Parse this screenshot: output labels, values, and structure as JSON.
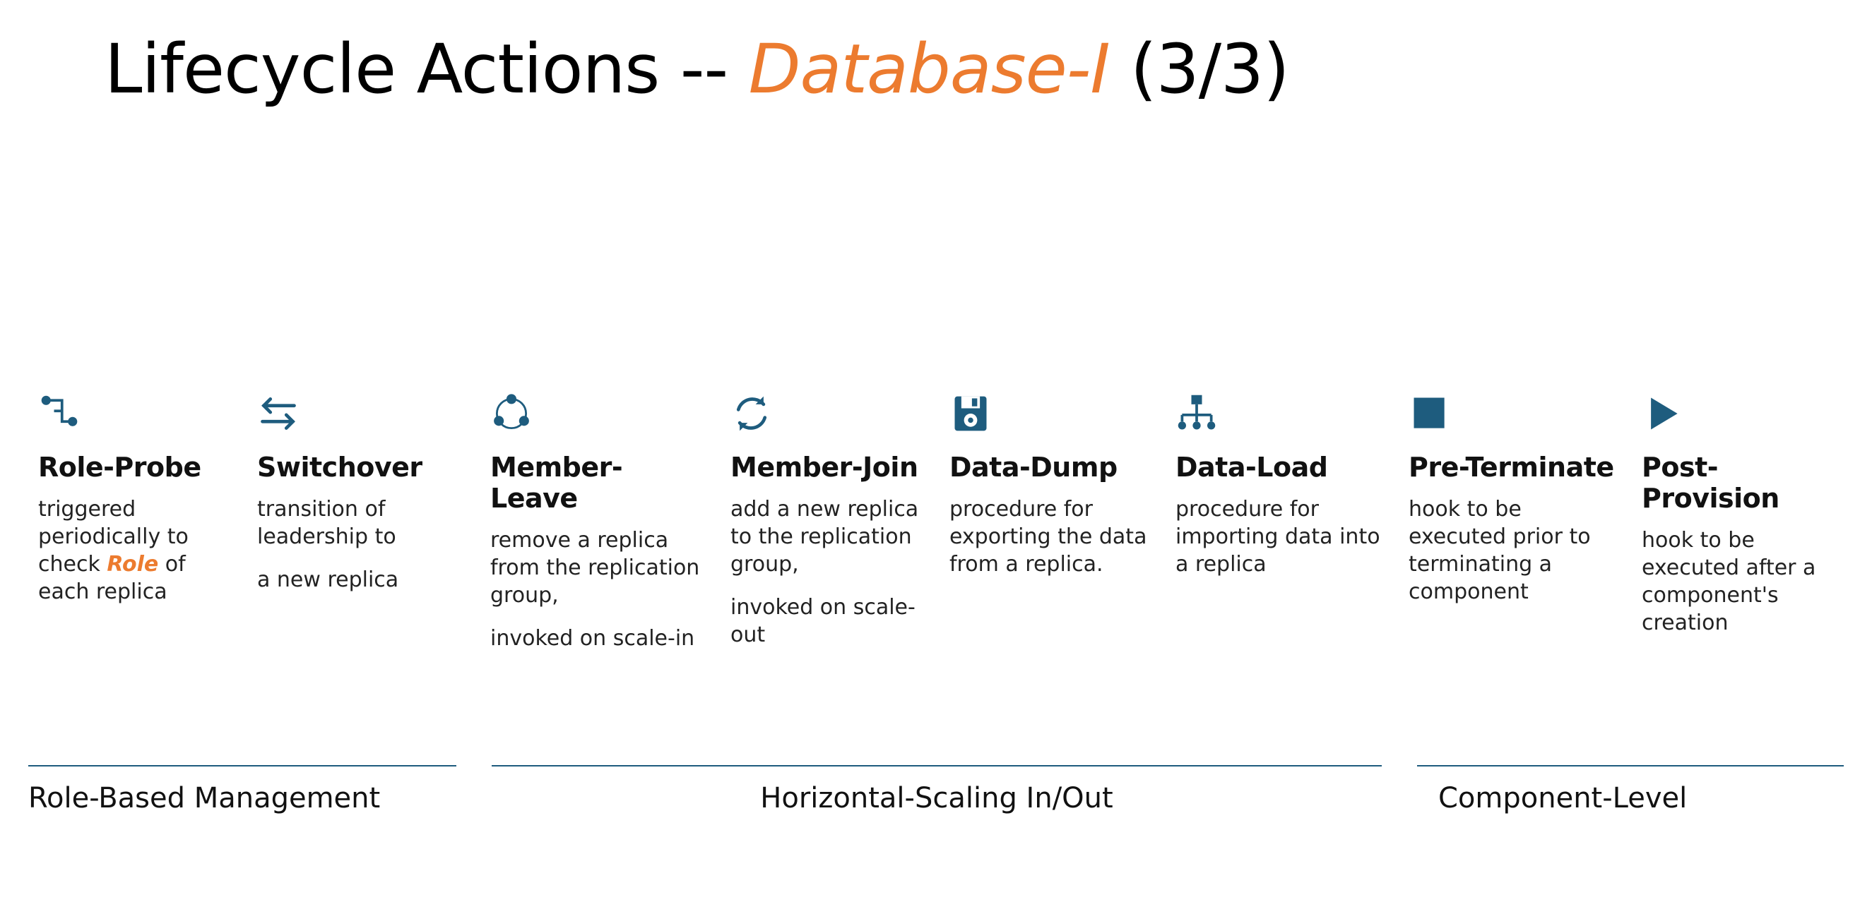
{
  "heading": {
    "prefix": "Lifecycle Actions -- ",
    "em": "Database-I",
    "suffix": " (3/3)"
  },
  "accentColor": "#EC7B2F",
  "iconColor": "#1E5C7E",
  "cards": [
    {
      "icon": "connect-icon",
      "title": "Role-Probe",
      "desc_pre": "triggered periodically to check ",
      "desc_key": "Role",
      "desc_post": " of each replica"
    },
    {
      "icon": "swap-icon",
      "title": "Switchover",
      "desc": "transition of leadership to",
      "desc2": "a new replica"
    },
    {
      "icon": "cycle-dots-icon",
      "title": "Member-Leave",
      "desc": "remove a replica from the replication group,",
      "desc2": "invoked on scale-in"
    },
    {
      "icon": "refresh-icon",
      "title": "Member-Join",
      "desc": "add a new replica to the replication group,",
      "desc2": "invoked on scale-out"
    },
    {
      "icon": "disk-icon",
      "title": "Data-Dump",
      "desc": "procedure for exporting the data from a replica."
    },
    {
      "icon": "tree-icon",
      "title": "Data-Load",
      "desc": "procedure for importing data into a replica"
    },
    {
      "icon": "square-icon",
      "title": "Pre-Terminate",
      "desc": "hook to be executed prior to terminating a component"
    },
    {
      "icon": "play-icon",
      "title": "Post-Provision",
      "desc": "hook to be executed after a component's creation"
    }
  ],
  "groups": [
    {
      "label": "Role-Based Management"
    },
    {
      "label": "Horizontal-Scaling In/Out"
    },
    {
      "label": "Component-Level"
    }
  ]
}
